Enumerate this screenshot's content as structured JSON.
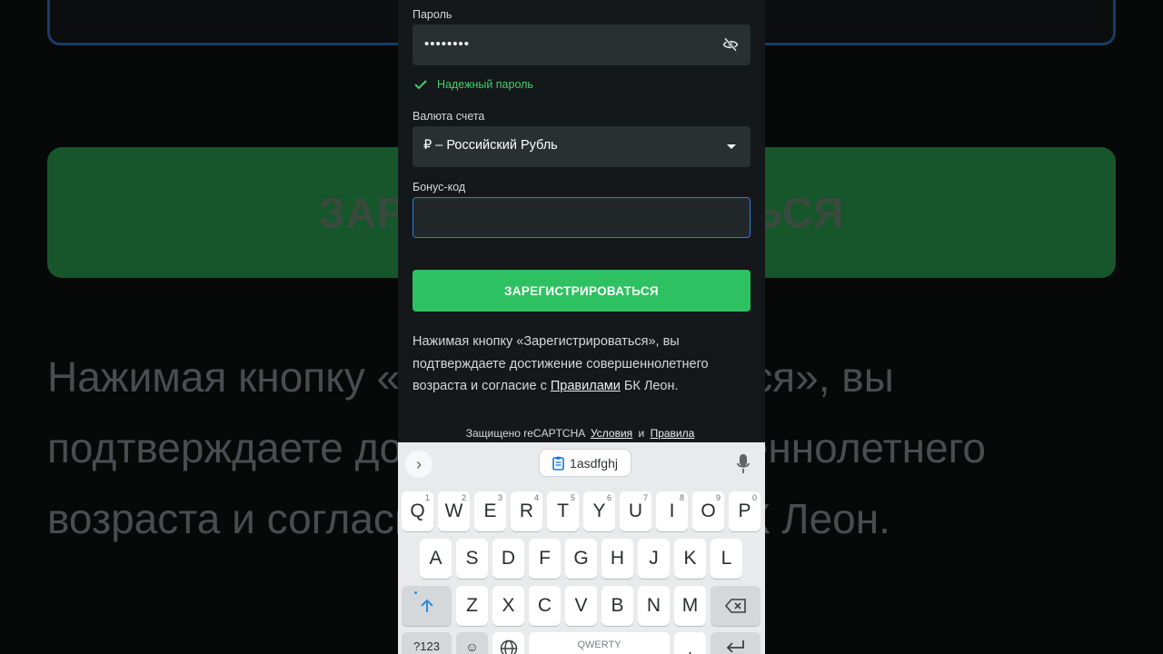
{
  "background": {
    "button_text_partial": "ЗАРЕГИСТРИРОВАТЬСЯ",
    "disclaimer_lines": [
      "Нажимая кнопку «Зарегистрироваться», вы",
      "подтверждаете достижение совершеннолетнего",
      "возраста и согласие с Правилами БК Леон."
    ]
  },
  "form": {
    "password_label": "Пароль",
    "password_value": "••••••••",
    "password_strength": "Надежный пароль",
    "currency_label": "Валюта счета",
    "currency_value": "₽ – Российский Рубль",
    "bonus_label": "Бонус-код",
    "bonus_value": "",
    "register_button": "ЗАРЕГИСТРИРОВАТЬСЯ",
    "disclaimer_before": "Нажимая кнопку «Зарегистрироваться», вы подтверждаете достижение совершеннолетнего возраста и согласие с ",
    "disclaimer_link": "Правилами",
    "disclaimer_after": " БК Леон.",
    "captcha_text": "Защищено reCAPTCHA",
    "captcha_terms": "Условия",
    "captcha_and": "и",
    "captcha_rules": "Правила"
  },
  "keyboard": {
    "clipboard_text": "1asdfghj",
    "row1": [
      {
        "key": "Q",
        "num": "1"
      },
      {
        "key": "W",
        "num": "2"
      },
      {
        "key": "E",
        "num": "3"
      },
      {
        "key": "R",
        "num": "4"
      },
      {
        "key": "T",
        "num": "5"
      },
      {
        "key": "Y",
        "num": "6"
      },
      {
        "key": "U",
        "num": "7"
      },
      {
        "key": "I",
        "num": "8"
      },
      {
        "key": "O",
        "num": "9"
      },
      {
        "key": "P",
        "num": "0"
      }
    ],
    "row2": [
      "A",
      "S",
      "D",
      "F",
      "G",
      "H",
      "J",
      "K",
      "L"
    ],
    "row3": [
      "Z",
      "X",
      "C",
      "V",
      "B",
      "N",
      "M"
    ],
    "symbols_key": "?123",
    "emoji_key": "☺",
    "space_label": "QWERTY",
    "shift_icon": "shift-arrow-icon",
    "backspace_icon": "backspace-icon",
    "enter_icon": "enter-icon"
  },
  "colors": {
    "accent_green": "#2ec161",
    "strength_green": "#3fcf6b",
    "focus_blue": "#2f7de1"
  }
}
